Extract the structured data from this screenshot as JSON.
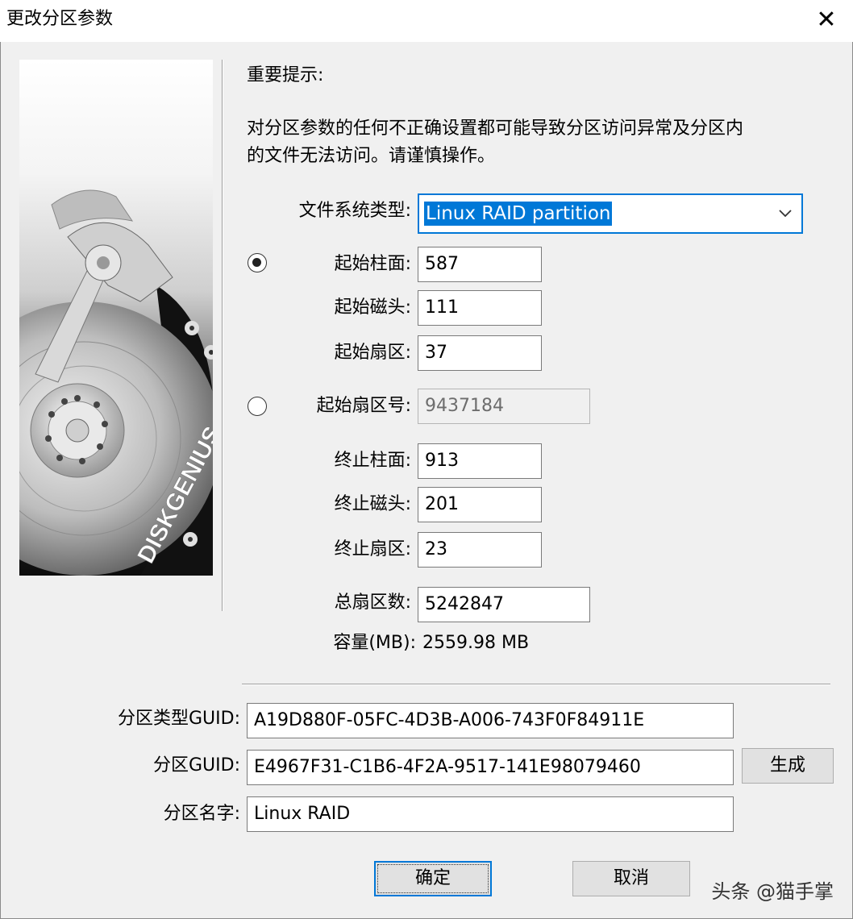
{
  "window": {
    "title": "更改分区参数"
  },
  "notice": {
    "heading": "重要提示:",
    "line1": "对分区参数的任何不正确设置都可能导致分区访问异常及分区内",
    "line2": "的文件无法访问。请谨慎操作。"
  },
  "illustration": {
    "brand_text": "DISKGENIUS"
  },
  "fs_type": {
    "label": "文件系统类型:",
    "value": "Linux RAID partition"
  },
  "chs_start": {
    "selected": true,
    "cylinder_label": "起始柱面:",
    "cylinder": "587",
    "head_label": "起始磁头:",
    "head": "111",
    "sector_label": "起始扇区:",
    "sector": "37"
  },
  "lba_start": {
    "selected": false,
    "label": "起始扇区号:",
    "value": "9437184"
  },
  "chs_end": {
    "cylinder_label": "终止柱面:",
    "cylinder": "913",
    "head_label": "终止磁头:",
    "head": "201",
    "sector_label": "终止扇区:",
    "sector": "23"
  },
  "total_sectors": {
    "label": "总扇区数:",
    "value": "5242847"
  },
  "capacity": {
    "label": "容量(MB):",
    "value": "2559.98 MB"
  },
  "guid": {
    "type_label": "分区类型GUID:",
    "type_value": "A19D880F-05FC-4D3B-A006-743F0F84911E",
    "part_label": "分区GUID:",
    "part_value": "E4967F31-C1B6-4F2A-9517-141E98079460",
    "generate_label": "生成"
  },
  "name": {
    "label": "分区名字:",
    "value": "Linux RAID"
  },
  "buttons": {
    "ok": "确定",
    "cancel": "取消"
  },
  "watermark": "头条 @猫手掌"
}
